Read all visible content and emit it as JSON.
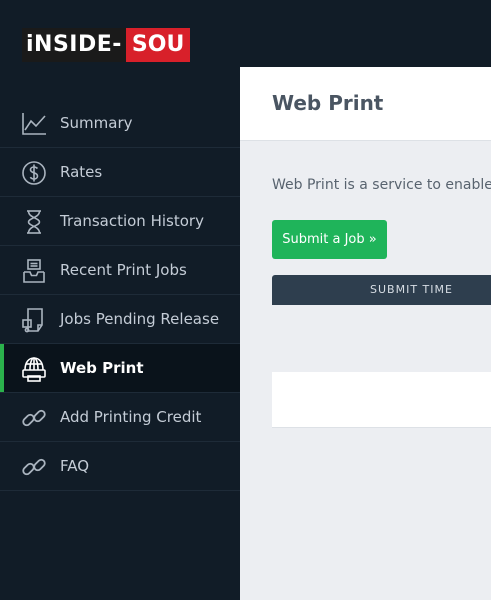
{
  "brand": {
    "logo_left": "iNSIDE-",
    "logo_right": "SOU"
  },
  "sidebar": {
    "items": [
      {
        "label": "Summary",
        "icon": "chart-line-icon"
      },
      {
        "label": "Rates",
        "icon": "dollar-circle-icon"
      },
      {
        "label": "Transaction History",
        "icon": "hourglass-icon"
      },
      {
        "label": "Recent Print Jobs",
        "icon": "inbox-tray-icon"
      },
      {
        "label": "Jobs Pending Release",
        "icon": "printer-document-icon"
      },
      {
        "label": "Web Print",
        "icon": "globe-printer-icon",
        "active": true
      },
      {
        "label": "Add Printing Credit",
        "icon": "link-icon"
      },
      {
        "label": "FAQ",
        "icon": "link-icon"
      }
    ]
  },
  "main": {
    "title": "Web Print",
    "intro": "Web Print is a service to enable p",
    "submit_button": "Submit a Job »",
    "table": {
      "columns": [
        "SUBMIT TIME"
      ]
    }
  },
  "colors": {
    "sidebar_bg": "#111c27",
    "active_accent": "#2bb24c",
    "primary_button": "#1fb45a",
    "table_header": "#2e3e4e",
    "logo_red": "#d8202a"
  }
}
